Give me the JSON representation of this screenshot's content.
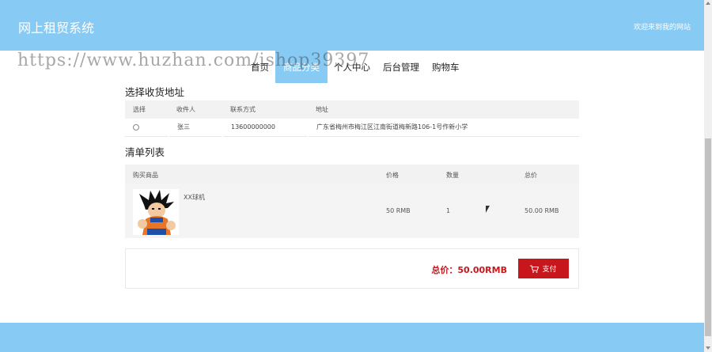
{
  "header": {
    "brand": "网上租贸系统",
    "welcome": "欢迎来到我的网站"
  },
  "nav": {
    "items": [
      {
        "label": "首页"
      },
      {
        "label": "商品分类"
      },
      {
        "label": "个人中心"
      },
      {
        "label": "后台管理"
      },
      {
        "label": "购物车"
      }
    ],
    "active_index": 1
  },
  "watermark": "https://www.huzhan.com/ishop39397",
  "address_section": {
    "title": "选择收货地址",
    "columns": [
      "选择",
      "收件人",
      "联系方式",
      "地址"
    ],
    "rows": [
      {
        "recipient": "张三",
        "phone": "13600000000",
        "address": "广东省梅州市梅江区江南街道梅新路106-1号作新小学"
      }
    ]
  },
  "order_section": {
    "title": "清单列表",
    "columns": [
      "购买商品",
      "价格",
      "数量",
      "总价"
    ],
    "items": [
      {
        "name": "XX球机",
        "price": "50 RMB",
        "quantity": "1",
        "total": "50.00 RMB"
      }
    ]
  },
  "summary": {
    "total_label": "总价：50.00RMB",
    "pay_label": "支付"
  },
  "colors": {
    "header_bg": "#87CAF4",
    "accent_red": "#c8161d"
  }
}
